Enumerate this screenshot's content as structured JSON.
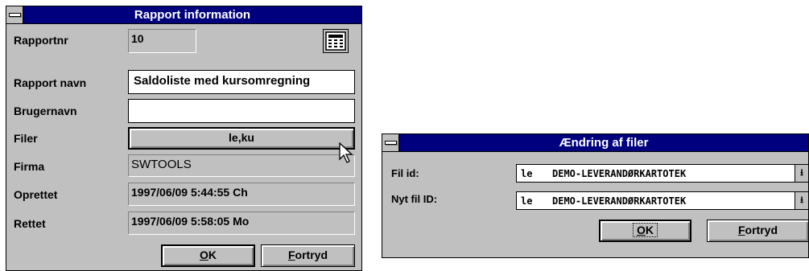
{
  "rapport_window": {
    "title": "Rapport information",
    "rapportnr_label": "Rapportnr",
    "rapportnr_value": "10",
    "rapport_navn_label": "Rapport navn",
    "rapport_navn_value": "Saldoliste med kursomregning",
    "brugernavn_label": "Brugernavn",
    "brugernavn_value": "",
    "filer_label": "Filer",
    "filer_button": "le,ku",
    "firma_label": "Firma",
    "firma_value": "SWTOOLS",
    "oprettet_label": "Oprettet",
    "oprettet_value": "1997/06/09 5:44:55  Ch",
    "rettet_label": "Rettet",
    "rettet_value": "1997/06/09 5:58:05  Mo",
    "ok_mnemonic": "O",
    "ok_rest": "K",
    "cancel_mnemonic": "F",
    "cancel_rest": "ortryd"
  },
  "fil_window": {
    "title": "Ændring af filer",
    "fil_id_label": "Fil id:",
    "fil_id_code": "le",
    "fil_id_value": "DEMO-LEVERANDØRKARTOTEK",
    "nyt_fil_label": "Nyt fil ID:",
    "nyt_fil_code": "le",
    "nyt_fil_value": "DEMO-LEVERANDØRKARTOTEK",
    "ok_mnemonic": "O",
    "ok_rest": "K",
    "cancel_mnemonic": "F",
    "cancel_rest": "ortryd"
  },
  "icons": [
    "system-menu-icon",
    "calculator-icon",
    "dropdown-arrow-icon",
    "mouse-pointer-icon"
  ]
}
